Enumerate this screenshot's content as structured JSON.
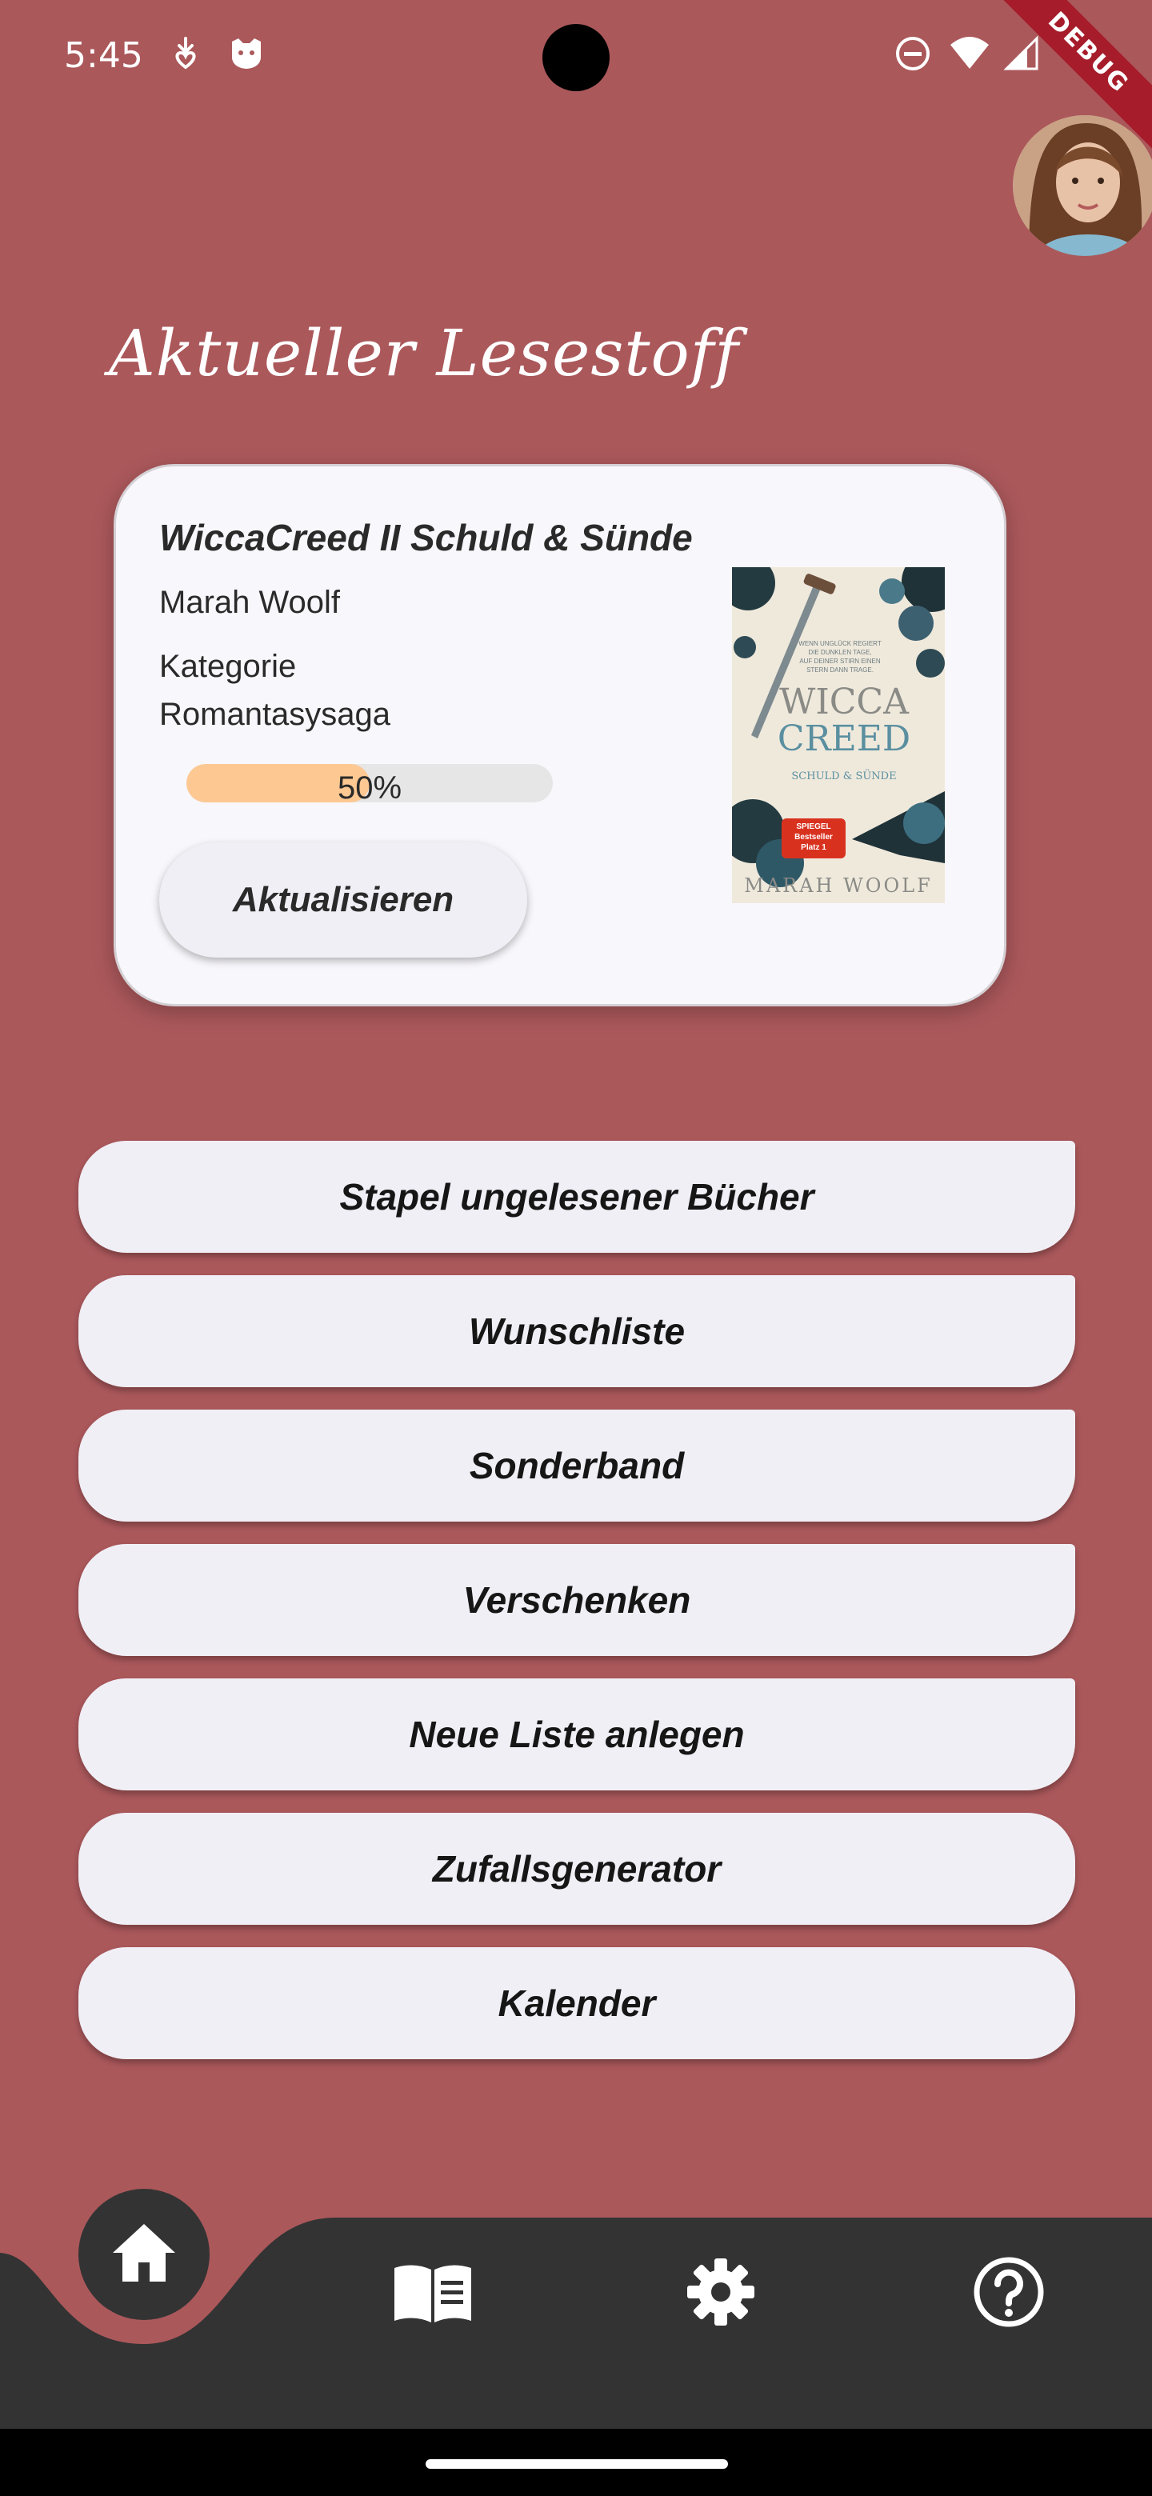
{
  "status_bar": {
    "time": "5:45",
    "left_icons": [
      "download-heart-icon",
      "cat-icon"
    ],
    "right_icons": [
      "dnd-icon",
      "wifi-icon",
      "signal-icon"
    ],
    "debug_label": "DEBUG"
  },
  "page": {
    "title": "Aktueller Lesestoff"
  },
  "current_book": {
    "title": "WiccaCreed II Schuld & Sünde",
    "author": "Marah Woolf",
    "category_label": "Kategorie",
    "category_value": "Romantasysaga",
    "progress_percent": 50,
    "progress_text": "50%",
    "update_label": "Aktualisieren",
    "cover": {
      "tagline_1": "WENN UNGLÜCK REGIERT",
      "tagline_2": "DIE DUNKLEN TAGE,",
      "tagline_3": "AUF DEINER STIRN EINEN",
      "tagline_4": "STERN DANN TRAGE.",
      "title_line_1": "WICCA",
      "title_line_2": "CREED",
      "subtitle": "SCHULD & SÜNDE",
      "badge_1": "SPIEGEL",
      "badge_2": "Bestseller",
      "badge_3": "Platz 1",
      "author": "MARAH WOOLF"
    }
  },
  "menu": [
    {
      "label": "Stapel ungelesener Bücher"
    },
    {
      "label": "Wunschliste"
    },
    {
      "label": "Sonderband"
    },
    {
      "label": "Verschenken"
    },
    {
      "label": "Neue Liste anlegen"
    },
    {
      "label": "Zufallsgenerator"
    },
    {
      "label": "Kalender"
    }
  ],
  "bottom_nav": {
    "items": [
      "home-icon",
      "book-icon",
      "settings-icon",
      "help-icon"
    ],
    "active": "home-icon"
  },
  "colors": {
    "background": "#ab585b",
    "card": "#f8f7fb",
    "button": "#f0eff5",
    "nav": "#333333",
    "progress_fill": "#fdc892",
    "progress_track": "#e6e6e6"
  }
}
